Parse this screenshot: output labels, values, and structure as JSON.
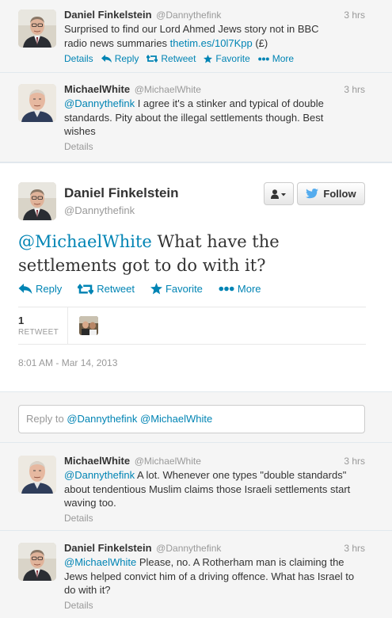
{
  "tweets_above": [
    {
      "name": "Daniel Finkelstein",
      "handle": "@Dannythefink",
      "time": "3 hrs",
      "text_pre": "Surprised to find our Lord Ahmed Jews story not in BBC radio news summaries ",
      "link": "thetim.es/10l7Kpp",
      "text_post": " (£)",
      "actions": {
        "details": "Details",
        "reply": "Reply",
        "retweet": "Retweet",
        "favorite": "Favorite",
        "more": "More"
      }
    },
    {
      "name": "MichaelWhite",
      "handle": "@MichaelWhite",
      "time": "3 hrs",
      "mention": "@Dannythefink",
      "text": " I agree it's a stinker and typical of double standards. Pity about the illegal settlements though. Best wishes",
      "details": "Details"
    }
  ],
  "main_tweet": {
    "name": "Daniel Finkelstein",
    "handle": "@Dannythefink",
    "follow_label": "Follow",
    "mention": "@MichaelWhite",
    "text": " What have the settlements got to do with it?",
    "actions": {
      "reply": "Reply",
      "retweet": "Retweet",
      "favorite": "Favorite",
      "more": "More"
    },
    "retweet_count": "1",
    "retweet_label": "RETWEET",
    "timestamp": "8:01 AM - Mar 14, 2013"
  },
  "reply_box": {
    "prefix": "Reply to ",
    "mention1": "@Dannythefink",
    "mention2": "@MichaelWhite"
  },
  "replies": [
    {
      "name": "MichaelWhite",
      "handle": "@MichaelWhite",
      "time": "3 hrs",
      "mention": "@Dannythefink",
      "text": " A lot. Whenever one types \"double standards\" about tendentious Muslim claims those Israeli settlements start waving too.",
      "details": "Details"
    },
    {
      "name": "Daniel Finkelstein",
      "handle": "@Dannythefink",
      "time": "3 hrs",
      "mention": "@MichaelWhite",
      "text": " Please, no. A Rotherham man is claiming the Jews helped convict him of a driving offence. What has Israel to do with it?",
      "details": "Details"
    }
  ],
  "colors": {
    "link": "#0084b4",
    "background_grey": "#f5f5f5",
    "muted": "#999999",
    "text": "#333333"
  }
}
